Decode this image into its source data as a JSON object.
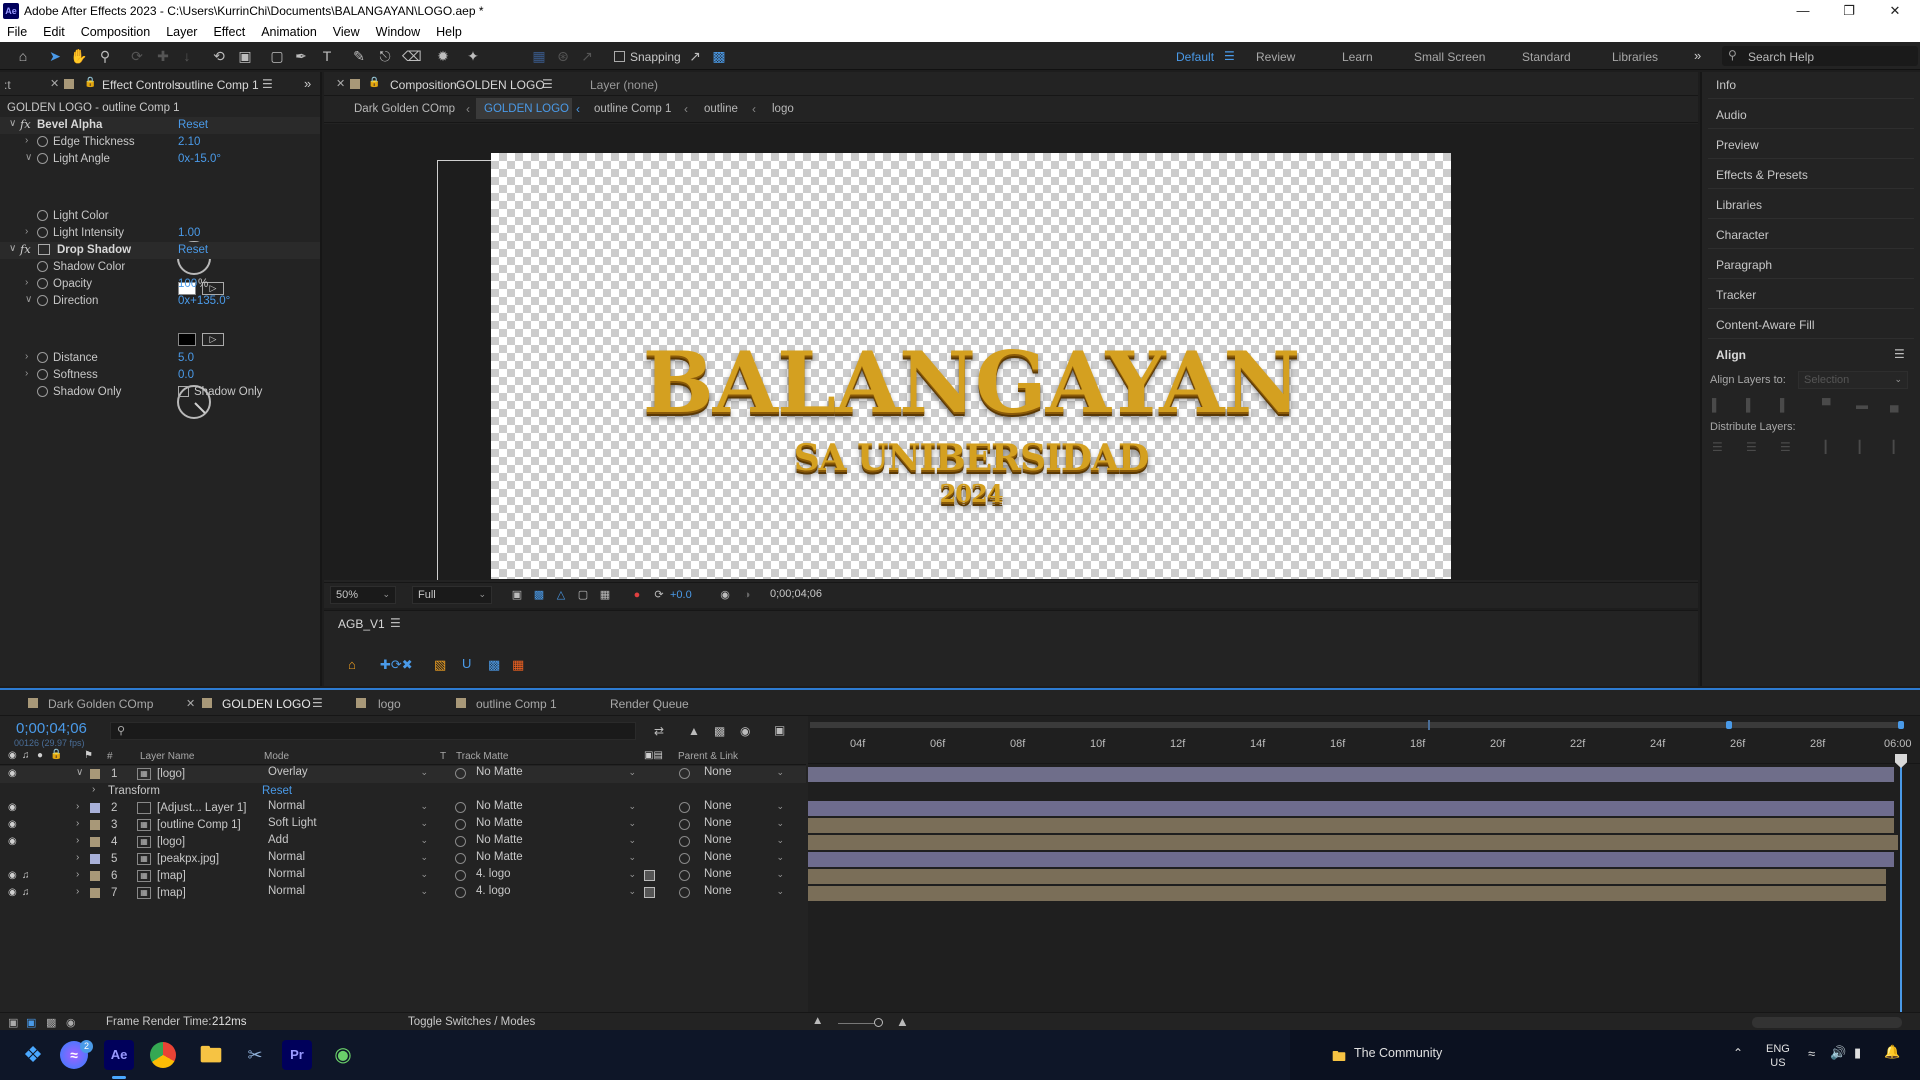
{
  "titlebar": {
    "app_icon": "Ae",
    "title": "Adobe After Effects 2023 - C:\\Users\\KurrinChi\\Documents\\BALANGAYAN\\LOGO.aep *"
  },
  "menu": [
    "File",
    "Edit",
    "Composition",
    "Layer",
    "Effect",
    "Animation",
    "View",
    "Window",
    "Help"
  ],
  "toolbar": {
    "snapping_label": "Snapping",
    "workspaces": [
      "Default",
      "Review",
      "Learn",
      "Small Screen",
      "Standard",
      "Libraries"
    ],
    "active_workspace": "Default",
    "search_placeholder": "Search Help"
  },
  "effect_controls": {
    "tab_label": "Effect Controls",
    "tab_target": "outline Comp 1",
    "subtitle": "GOLDEN LOGO - outline Comp 1",
    "bevel": {
      "name": "Bevel Alpha",
      "reset": "Reset",
      "edge_thickness_label": "Edge Thickness",
      "edge_thickness": "2.10",
      "light_angle_label": "Light Angle",
      "light_angle": "0x-15.0°",
      "light_color_label": "Light Color",
      "light_color": "#ffffff",
      "light_intensity_label": "Light Intensity",
      "light_intensity": "1.00"
    },
    "drop_shadow": {
      "name": "Drop Shadow",
      "reset": "Reset",
      "shadow_color_label": "Shadow Color",
      "shadow_color": "#000000",
      "opacity_label": "Opacity",
      "opacity": "100",
      "opacity_unit": "%",
      "direction_label": "Direction",
      "direction": "0x+135.0°",
      "distance_label": "Distance",
      "distance": "5.0",
      "softness_label": "Softness",
      "softness": "0.0",
      "shadow_only_label": "Shadow Only",
      "shadow_only_checkbox": "Shadow Only"
    }
  },
  "composition": {
    "tab_prefix": "Composition",
    "tab_name": "GOLDEN LOGO",
    "layer_tab": "Layer (none)",
    "breadcrumbs": [
      "Dark Golden COmp",
      "GOLDEN LOGO",
      "outline Comp 1",
      "outline",
      "logo"
    ],
    "logo_line1": "BALANGAYAN",
    "logo_line2": "SA UNIBERSIDAD",
    "logo_line3": "2024",
    "zoom": "50%",
    "resolution": "Full",
    "exposure": "+0.0",
    "timecode": "0;00;04;06"
  },
  "agb_panel": {
    "title": "AGB_V1"
  },
  "right_panel": {
    "items": [
      "Info",
      "Audio",
      "Preview",
      "Effects & Presets",
      "Libraries",
      "Character",
      "Paragraph",
      "Tracker",
      "Content-Aware Fill"
    ],
    "align_title": "Align",
    "align_layers_to": "Align Layers to:",
    "align_target": "Selection",
    "distribute_layers": "Distribute Layers:"
  },
  "timeline": {
    "tabs": [
      "Dark Golden COmp",
      "GOLDEN LOGO",
      "logo",
      "outline Comp 1",
      "Render Queue"
    ],
    "active_tab": "GOLDEN LOGO",
    "timecode": "0;00;04;06",
    "frame_info": "00126 (29.97 fps)",
    "headers": {
      "num": "#",
      "layer_name": "Layer Name",
      "mode": "Mode",
      "t": "T",
      "track_matte": "Track Matte",
      "parent": "Parent & Link"
    },
    "transform_label": "Transform",
    "transform_reset": "Reset",
    "layers": [
      {
        "num": "1",
        "name": "[logo]",
        "mode": "Overlay",
        "matte": "No Matte",
        "parent": "None",
        "color": "#a89878"
      },
      {
        "num": "2",
        "name": "[Adjust... Layer 1]",
        "mode": "Normal",
        "matte": "No Matte",
        "parent": "None",
        "color": "#a8b0d8"
      },
      {
        "num": "3",
        "name": "[outline Comp 1]",
        "mode": "Soft Light",
        "matte": "No Matte",
        "parent": "None",
        "color": "#a89878"
      },
      {
        "num": "4",
        "name": "[logo]",
        "mode": "Add",
        "matte": "No Matte",
        "parent": "None",
        "color": "#a89878"
      },
      {
        "num": "5",
        "name": "[peakpx.jpg]",
        "mode": "Normal",
        "matte": "No Matte",
        "parent": "None",
        "color": "#a8b0d8"
      },
      {
        "num": "6",
        "name": "[map]",
        "mode": "Normal",
        "matte": "4. logo",
        "parent": "None",
        "color": "#a89878"
      },
      {
        "num": "7",
        "name": "[map]",
        "mode": "Normal",
        "matte": "4. logo",
        "parent": "None",
        "color": "#a89878"
      }
    ],
    "ruler_ticks": [
      "04f",
      "06f",
      "08f",
      "10f",
      "12f",
      "14f",
      "16f",
      "18f",
      "20f",
      "22f",
      "24f",
      "26f",
      "28f",
      "06:00"
    ],
    "footer_render_label": "Frame Render Time:",
    "footer_render_value": "212ms",
    "footer_toggle": "Toggle Switches / Modes"
  },
  "taskbar": {
    "apps": [
      "windows-start",
      "messenger",
      "after-effects",
      "chrome",
      "file-explorer",
      "snipping",
      "premiere",
      "paint"
    ],
    "messenger_badge": "2",
    "notification_text": "The Community",
    "lang_line1": "ENG",
    "lang_line2": "US"
  }
}
